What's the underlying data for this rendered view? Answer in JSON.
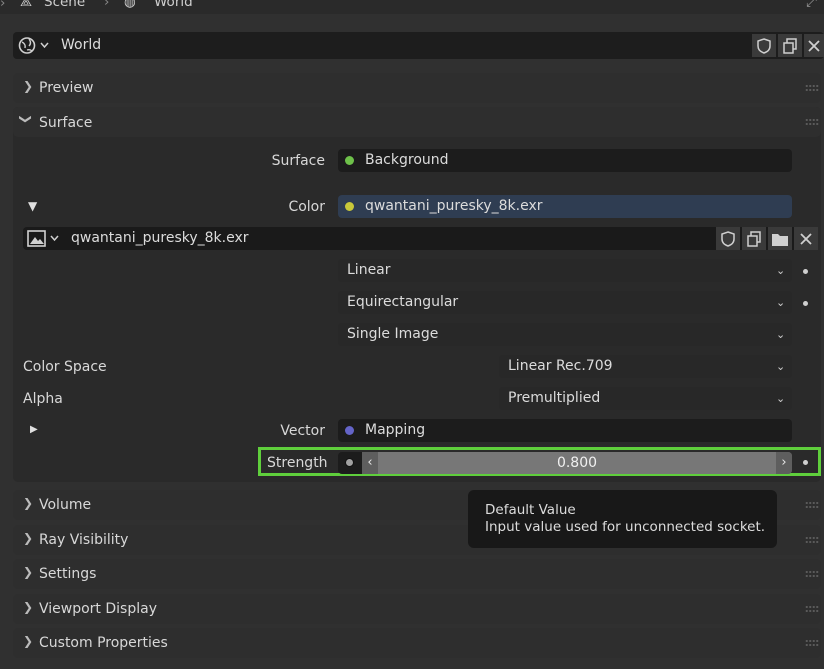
{
  "breadcrumb": {
    "scene": "Scene",
    "world": "World"
  },
  "datablock": {
    "name": "World",
    "icon": "world-icon"
  },
  "panels": {
    "preview": "Preview",
    "surface": "Surface",
    "volume": "Volume",
    "ray_visibility": "Ray Visibility",
    "settings": "Settings",
    "viewport_display": "Viewport Display",
    "custom_properties": "Custom Properties"
  },
  "surface": {
    "surface_label": "Surface",
    "surface_value": "Background",
    "color_label": "Color",
    "color_value": "qwantani_puresky_8k.exr",
    "image_name": "qwantani_puresky_8k.exr",
    "interpolation": "Linear",
    "projection": "Equirectangular",
    "source": "Single Image",
    "color_space_label": "Color Space",
    "color_space": "Linear Rec.709",
    "alpha_label": "Alpha",
    "alpha": "Premultiplied",
    "vector_label": "Vector",
    "vector_value": "Mapping",
    "strength_label": "Strength",
    "strength_value": "0.800"
  },
  "tooltip": {
    "title": "Default Value",
    "body": "Input value used for unconnected socket."
  },
  "colors": {
    "background_socket": "#6ec14a",
    "color_socket": "#c8c83a",
    "vector_socket": "#6464c8",
    "float_socket": "#a1a1a1",
    "highlight": "#5fcf3c"
  }
}
